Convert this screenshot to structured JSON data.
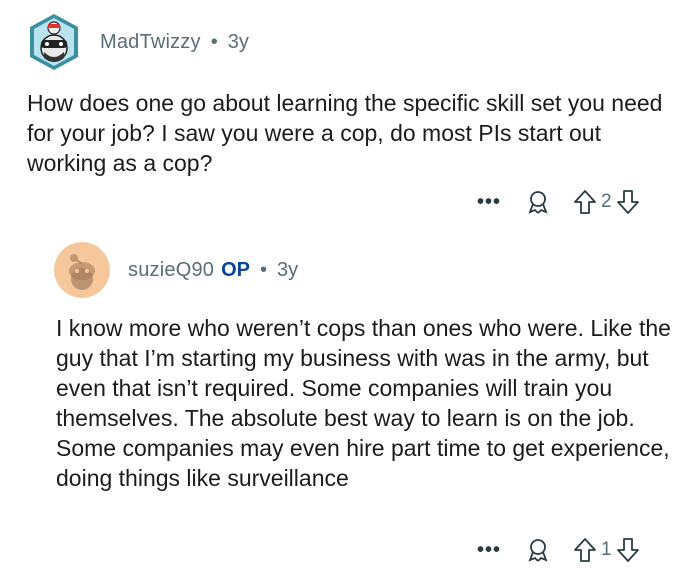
{
  "comments": [
    {
      "author": "MadTwizzy",
      "separator": "•",
      "age": "3y",
      "text": "How does one go about learning the specific skill set you need for your job?  I saw you were a cop, do most PIs start out working as a cop?",
      "more_label": "•••",
      "score": "2",
      "icons": [
        "avatar-robot-icon",
        "award-icon",
        "upvote-icon",
        "downvote-icon"
      ]
    },
    {
      "author": "suzieQ90",
      "op_badge": "OP",
      "separator": "•",
      "age": "3y",
      "text": "I know more who weren’t cops than ones who were. Like the guy that I’m starting my business with was in the army, but even that isn’t required. Some companies will train you themselves. The absolute best way to learn is on the job. Some companies may even hire part time to get experience, doing things like surveillance",
      "more_label": "•••",
      "score": "1",
      "icons": [
        "avatar-snoo-icon",
        "award-icon",
        "upvote-icon",
        "downvote-icon"
      ]
    }
  ],
  "colors": {
    "meta": "#576f76",
    "op": "#0a449b",
    "text": "#1c1c1c",
    "avatar_peach": "#f6c79a",
    "avatar_teal": "#3a8fa0"
  }
}
